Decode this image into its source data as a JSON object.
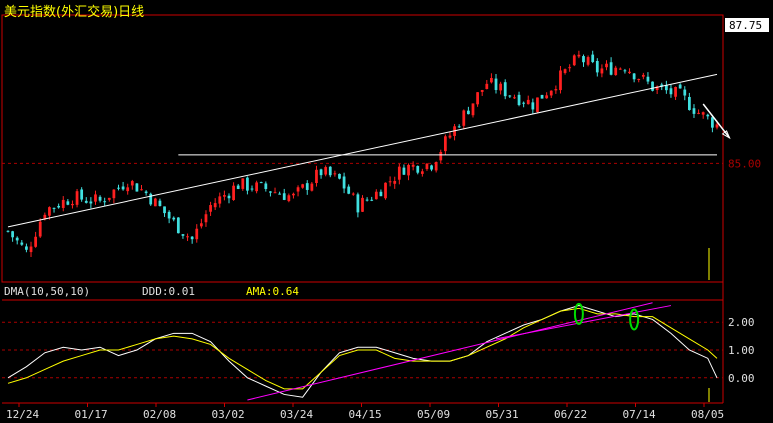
{
  "window": {
    "title": "美元指数(外汇交易)日线"
  },
  "indicator": {
    "name_label": "DMA(10,50,10)",
    "ddd_label": "DDD:0.01",
    "ama_label": "AMA:0.64"
  },
  "colors": {
    "background": "#000000",
    "frame": "#cc0000",
    "grid": "#aa0000",
    "axis_text": "#e0e0e0",
    "up_candle": "#ff2020",
    "down_candle": "#40e0e0",
    "trendline": "#ffffff",
    "title": "#ffff00",
    "ddd_line": "#ffffff",
    "ama_line": "#ffff00",
    "indicator_trendline": "#ff00ff",
    "highlight_ellipse": "#00dd00",
    "price_label_bg": "#ffffff",
    "price_label_text": "#000000"
  },
  "chart_data": [
    {
      "type": "candlestick",
      "title": "美元指数(外汇交易)日线",
      "x_tick_labels": [
        "12/24",
        "01/17",
        "02/08",
        "03/02",
        "03/24",
        "04/15",
        "05/09",
        "05/31",
        "06/22",
        "07/14",
        "08/05"
      ],
      "y_tick_labels": [
        "85.00"
      ],
      "ylim": [
        82.2,
        88.5
      ],
      "current_price_label": "87.75",
      "close_path": [
        [
          0,
          83.4
        ],
        [
          4,
          82.9
        ],
        [
          8,
          83.9
        ],
        [
          14,
          84.2
        ],
        [
          20,
          84.1
        ],
        [
          26,
          84.6
        ],
        [
          30,
          84.3
        ],
        [
          36,
          83.6
        ],
        [
          40,
          83.2
        ],
        [
          44,
          84.0
        ],
        [
          50,
          84.5
        ],
        [
          56,
          84.4
        ],
        [
          62,
          84.2
        ],
        [
          68,
          84.8
        ],
        [
          72,
          84.6
        ],
        [
          76,
          84.0
        ],
        [
          80,
          84.3
        ],
        [
          86,
          84.9
        ],
        [
          92,
          85.0
        ],
        [
          98,
          86.0
        ],
        [
          104,
          86.9
        ],
        [
          110,
          86.6
        ],
        [
          114,
          86.4
        ],
        [
          118,
          86.8
        ],
        [
          124,
          87.5
        ],
        [
          128,
          87.2
        ],
        [
          134,
          87.3
        ],
        [
          140,
          86.8
        ],
        [
          146,
          86.6
        ],
        [
          150,
          86.2
        ],
        [
          154,
          85.9
        ]
      ],
      "candles_count": 155,
      "grid_y_values": [
        85.0
      ],
      "annotations": {
        "horizontal_line_at": 85.2,
        "horizontal_line_from": 37,
        "horizontal_line_to": 154,
        "ascending_trendline": {
          "from": [
            0,
            83.5
          ],
          "to": [
            154,
            87.1
          ]
        },
        "forecast_arrow": {
          "from": [
            151,
            86.4
          ],
          "to": [
            155,
            85.6
          ]
        }
      }
    },
    {
      "type": "line",
      "title": "DMA(10,50,10)",
      "ylim": [
        -0.8,
        2.8
      ],
      "y_tick_labels": [
        "2.00",
        "1.00",
        "0.00"
      ],
      "grid_y_values": [
        2.0,
        1.0,
        0.0
      ],
      "series": [
        {
          "name": "DDD",
          "points": [
            [
              0,
              0.0
            ],
            [
              4,
              0.4
            ],
            [
              8,
              0.9
            ],
            [
              12,
              1.1
            ],
            [
              16,
              1.0
            ],
            [
              20,
              1.1
            ],
            [
              24,
              0.8
            ],
            [
              28,
              1.0
            ],
            [
              32,
              1.4
            ],
            [
              36,
              1.6
            ],
            [
              40,
              1.6
            ],
            [
              44,
              1.3
            ],
            [
              48,
              0.6
            ],
            [
              52,
              0.0
            ],
            [
              56,
              -0.3
            ],
            [
              60,
              -0.6
            ],
            [
              64,
              -0.7
            ],
            [
              68,
              0.2
            ],
            [
              72,
              0.9
            ],
            [
              76,
              1.1
            ],
            [
              80,
              1.1
            ],
            [
              84,
              0.9
            ],
            [
              88,
              0.7
            ],
            [
              92,
              0.6
            ],
            [
              96,
              0.6
            ],
            [
              100,
              0.8
            ],
            [
              104,
              1.3
            ],
            [
              108,
              1.6
            ],
            [
              112,
              1.9
            ],
            [
              116,
              2.1
            ],
            [
              120,
              2.4
            ],
            [
              124,
              2.6
            ],
            [
              128,
              2.4
            ],
            [
              132,
              2.2
            ],
            [
              136,
              2.3
            ],
            [
              140,
              2.1
            ],
            [
              144,
              1.6
            ],
            [
              148,
              1.0
            ],
            [
              152,
              0.7
            ],
            [
              154,
              0.0
            ]
          ]
        },
        {
          "name": "AMA",
          "points": [
            [
              0,
              -0.2
            ],
            [
              4,
              0.0
            ],
            [
              8,
              0.3
            ],
            [
              12,
              0.6
            ],
            [
              16,
              0.8
            ],
            [
              20,
              1.0
            ],
            [
              24,
              1.0
            ],
            [
              28,
              1.2
            ],
            [
              32,
              1.4
            ],
            [
              36,
              1.5
            ],
            [
              40,
              1.4
            ],
            [
              44,
              1.2
            ],
            [
              48,
              0.7
            ],
            [
              52,
              0.3
            ],
            [
              56,
              -0.1
            ],
            [
              60,
              -0.4
            ],
            [
              64,
              -0.4
            ],
            [
              68,
              0.2
            ],
            [
              72,
              0.8
            ],
            [
              76,
              1.0
            ],
            [
              80,
              1.0
            ],
            [
              84,
              0.7
            ],
            [
              88,
              0.6
            ],
            [
              92,
              0.6
            ],
            [
              96,
              0.6
            ],
            [
              100,
              0.8
            ],
            [
              104,
              1.1
            ],
            [
              108,
              1.4
            ],
            [
              112,
              1.8
            ],
            [
              116,
              2.1
            ],
            [
              120,
              2.4
            ],
            [
              124,
              2.5
            ],
            [
              128,
              2.3
            ],
            [
              132,
              2.3
            ],
            [
              136,
              2.2
            ],
            [
              140,
              2.2
            ],
            [
              144,
              1.8
            ],
            [
              148,
              1.4
            ],
            [
              152,
              1.0
            ],
            [
              154,
              0.7
            ]
          ]
        }
      ],
      "annotations": {
        "trendline_1": {
          "from": [
            52,
            -0.8
          ],
          "to": [
            140,
            2.7
          ]
        },
        "trendline_2": {
          "from": [
            106,
            1.4
          ],
          "to": [
            144,
            2.6
          ]
        },
        "highlight_ellipses_at": [
          [
            124,
            2.3
          ],
          [
            136,
            2.1
          ]
        ]
      }
    }
  ]
}
